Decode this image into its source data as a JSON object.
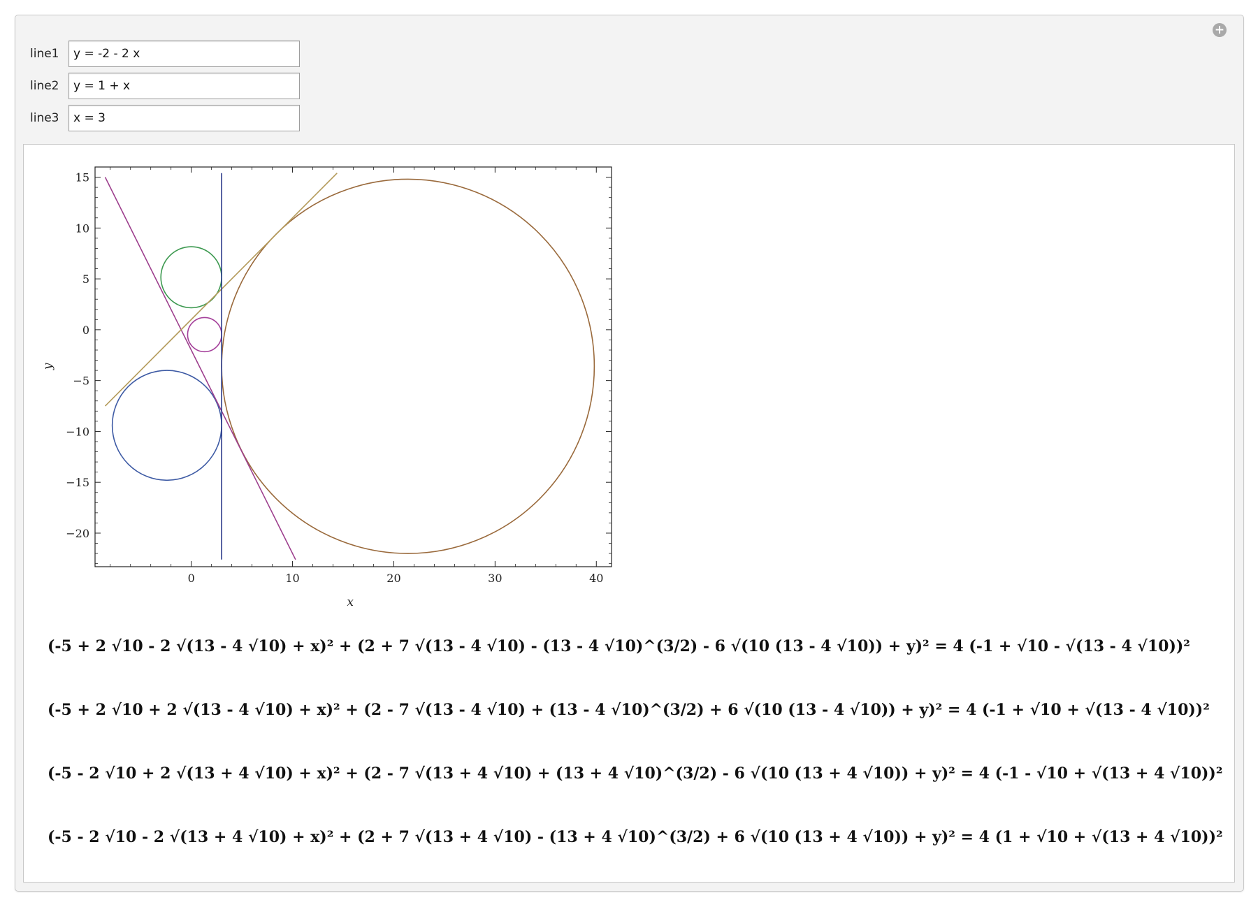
{
  "controls": [
    {
      "label": "line1",
      "value": "y = -2 - 2 x"
    },
    {
      "label": "line2",
      "value": "y = 1 + x"
    },
    {
      "label": "line3",
      "value": "x = 3"
    }
  ],
  "add_icon": "plus-circle-icon",
  "colors": {
    "line1": "#9d3f8d",
    "line2": "#b39a5a",
    "line3": "#2a3a8a",
    "circle_green": "#3d9950",
    "circle_purple": "#a43f9a",
    "circle_blue": "#3d5aa4",
    "circle_brown": "#9a6a3c"
  },
  "chart_data": {
    "type": "line",
    "title": "",
    "xlabel": "x",
    "ylabel": "y",
    "xlim": [
      -9.5,
      41.5
    ],
    "ylim": [
      -23.3,
      16
    ],
    "xticks": [
      0,
      10,
      20,
      30,
      40
    ],
    "yticks": [
      15,
      10,
      5,
      0,
      -5,
      -10,
      -15,
      -20
    ],
    "grid": false,
    "lines": [
      {
        "x": [
          -8.5,
          10.3
        ],
        "y": [
          15,
          -22.6
        ]
      },
      {
        "x": [
          -8.5,
          14.4
        ],
        "y": [
          -7.5,
          15.4
        ]
      },
      {
        "x": [
          3,
          3
        ],
        "y": [
          -22.6,
          15.4
        ]
      }
    ],
    "circles": [
      {
        "cx": 0,
        "cy": 5.16,
        "r": 3.0
      },
      {
        "cx": 1.32,
        "cy": -0.48,
        "r": 1.68
      },
      {
        "cx": -2.4,
        "cy": -9.4,
        "r": 5.4
      },
      {
        "cx": 21.4,
        "cy": -3.6,
        "r": 18.4
      }
    ]
  },
  "equations": [
    "(-5 + 2 √10 - 2 √(13 - 4 √10) + x)² + (2 + 7 √(13 - 4 √10) - (13 - 4 √10)^(3/2) - 6 √(10 (13 - 4 √10)) + y)² = 4 (-1 + √10 - √(13 - 4 √10))²",
    "(-5 + 2 √10 + 2 √(13 - 4 √10) + x)² + (2 - 7 √(13 - 4 √10) + (13 - 4 √10)^(3/2) + 6 √(10 (13 - 4 √10)) + y)² = 4 (-1 + √10 + √(13 - 4 √10))²",
    "(-5 - 2 √10 + 2 √(13 + 4 √10) + x)² + (2 - 7 √(13 + 4 √10) + (13 + 4 √10)^(3/2) - 6 √(10 (13 + 4 √10)) + y)² = 4 (-1 - √10 + √(13 + 4 √10))²",
    "(-5 - 2 √10 - 2 √(13 + 4 √10) + x)² + (2 + 7 √(13 + 4 √10) - (13 + 4 √10)^(3/2) + 6 √(10 (13 + 4 √10)) + y)² = 4 (1 + √10 + √(13 + 4 √10))²"
  ]
}
